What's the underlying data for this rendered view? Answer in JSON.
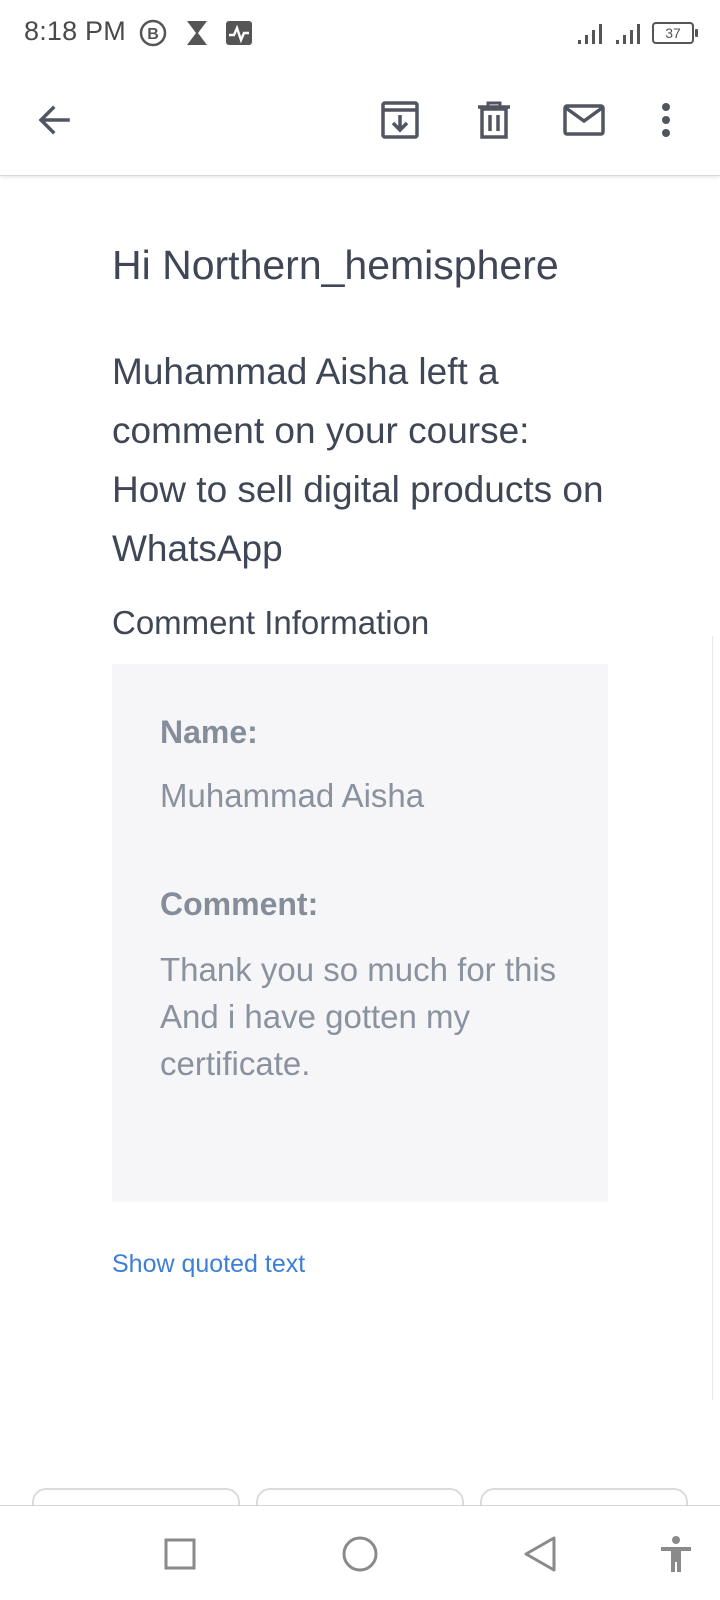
{
  "status_bar": {
    "time": "8:18 PM",
    "battery": "37",
    "icons": [
      "b-circle-icon",
      "hourglass-icon",
      "activity-icon",
      "signal-icon",
      "signal-icon",
      "battery-icon"
    ]
  },
  "app_bar": {
    "actions": [
      "back-arrow-icon",
      "archive-icon",
      "delete-icon",
      "mark-unread-icon",
      "more-options-icon"
    ]
  },
  "email": {
    "greeting": "Hi Northern_hemisphere",
    "message": "Muhammad Aisha left a comment on your course: How to sell digital products on WhatsApp",
    "section_title": "Comment Information",
    "name_label": "Name:",
    "name_value": "Muhammad Aisha",
    "comment_label": "Comment:",
    "comment_value": "Thank you so much for this And i have gotten my certificate.",
    "show_quoted": "Show quoted text"
  },
  "nav_bar": {
    "buttons": [
      "recents-square-icon",
      "home-circle-icon",
      "back-triangle-icon",
      "accessibility-icon"
    ]
  },
  "colors": {
    "text_dark": "#3f4655",
    "text_muted": "#8a929f",
    "card_bg": "#f6f6f8",
    "link": "#3d7fd8"
  }
}
